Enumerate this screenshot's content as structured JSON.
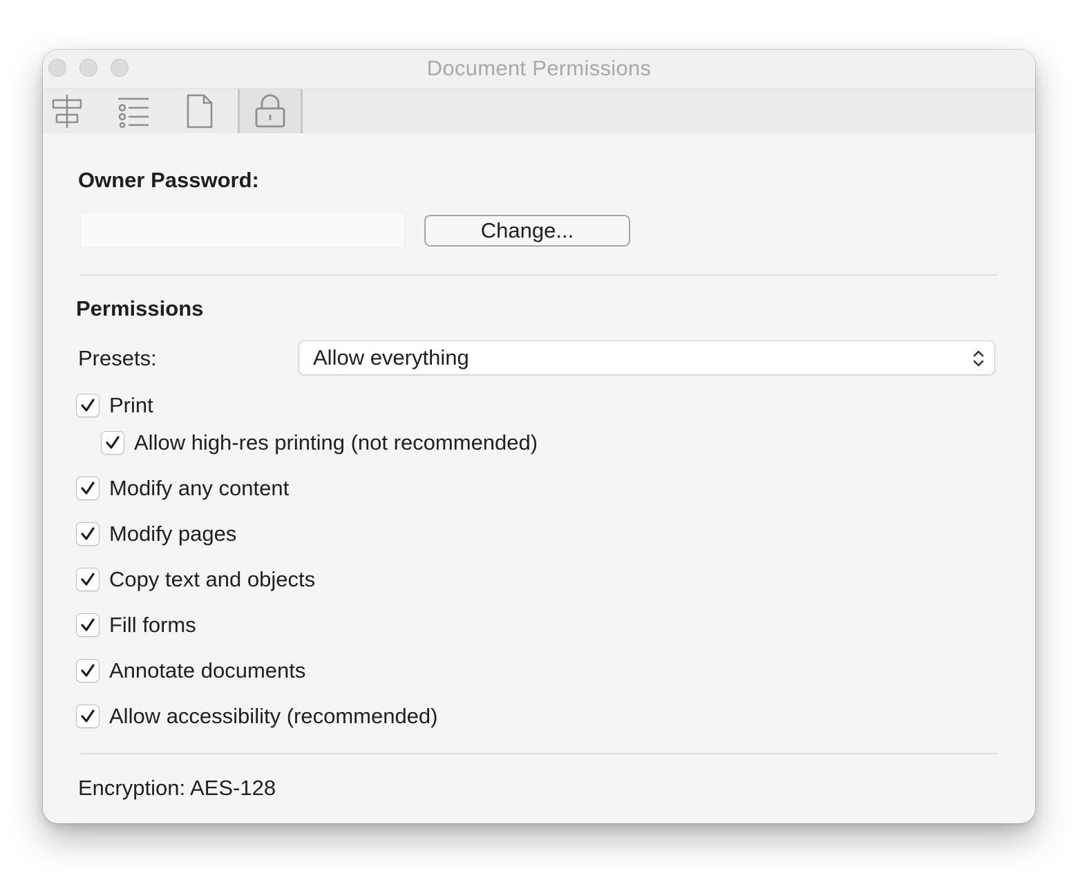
{
  "window": {
    "title": "Document Permissions"
  },
  "toolbar": {
    "tabs": [
      {
        "icon": "align-center-icon",
        "selected": false
      },
      {
        "icon": "list-icon",
        "selected": false
      },
      {
        "icon": "document-icon",
        "selected": false
      },
      {
        "icon": "lock-icon",
        "selected": true
      }
    ]
  },
  "owner": {
    "label": "Owner Password:",
    "password_value": "",
    "change_label": "Change..."
  },
  "permissions": {
    "heading": "Permissions",
    "presets_label": "Presets:",
    "presets_value": "Allow everything",
    "options": [
      {
        "label": "Print",
        "checked": true
      },
      {
        "label": "Allow high-res printing (not recommended)",
        "checked": true
      },
      {
        "label": "Modify any content",
        "checked": true
      },
      {
        "label": "Modify pages",
        "checked": true
      },
      {
        "label": "Copy text and objects",
        "checked": true
      },
      {
        "label": "Fill forms",
        "checked": true
      },
      {
        "label": "Annotate documents",
        "checked": true
      },
      {
        "label": "Allow accessibility (recommended)",
        "checked": true
      }
    ]
  },
  "encryption": {
    "label": "Encryption: AES-128"
  }
}
